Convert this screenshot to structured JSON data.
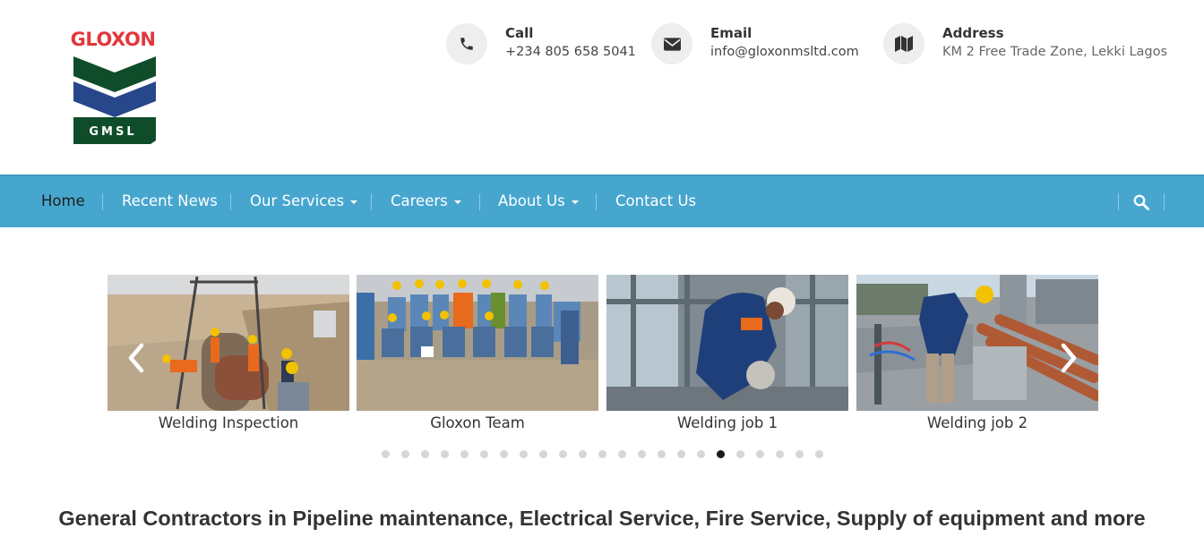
{
  "logo": {
    "brand": "GLOXON",
    "sub": "GMSL"
  },
  "contacts": [
    {
      "label": "Call",
      "value": "+234 805 658 5041",
      "icon": "phone-icon"
    },
    {
      "label": "Email",
      "value": "info@gloxonmsltd.com",
      "icon": "envelope-icon"
    },
    {
      "label": "Address",
      "value": "KM 2 Free Trade Zone, Lekki Lagos",
      "icon": "map-icon"
    }
  ],
  "nav": {
    "items": [
      {
        "label": "Home",
        "active": true
      },
      {
        "label": "Recent News"
      },
      {
        "label": "Our Services",
        "dropdown": true
      },
      {
        "label": "Careers",
        "dropdown": true
      },
      {
        "label": "About Us",
        "dropdown": true
      },
      {
        "label": "Contact Us"
      }
    ],
    "search_icon": "search-icon"
  },
  "carousel": {
    "slides": [
      {
        "caption": "Welding Inspection"
      },
      {
        "caption": "Gloxon Team"
      },
      {
        "caption": "Welding job 1"
      },
      {
        "caption": "Welding job 2"
      }
    ],
    "dot_count": 23,
    "active_dot": 17
  },
  "tagline": "General Contractors in Pipeline maintenance, Electrical Service, Fire Service, Supply of equipment and more",
  "colors": {
    "nav_bg": "#46a6ce",
    "logo_red": "#e0383e",
    "logo_green": "#0f4d2a",
    "logo_blue": "#27478a"
  }
}
